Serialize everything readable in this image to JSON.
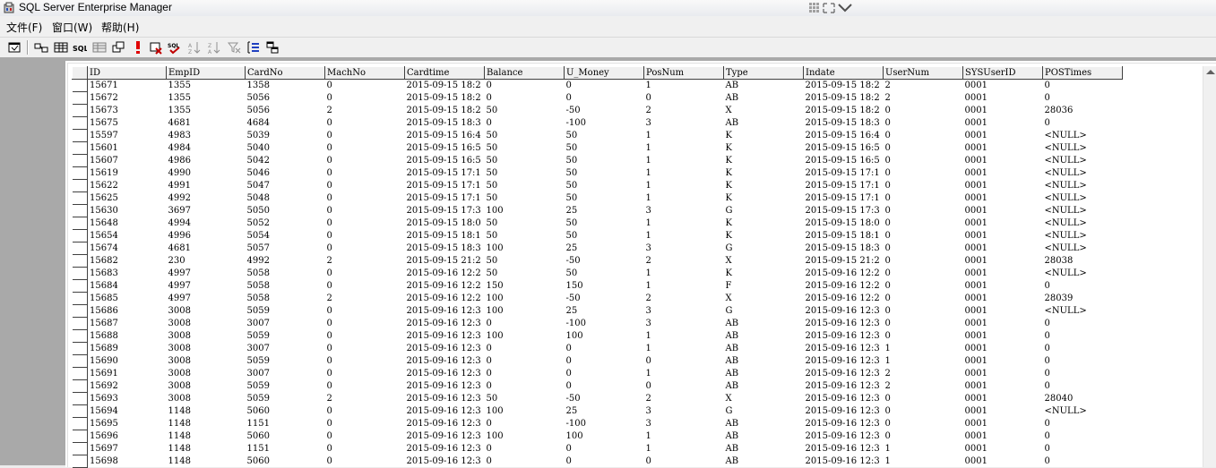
{
  "app": {
    "title": "SQL Server Enterprise Manager"
  },
  "menu": [
    {
      "label": "文件(F)"
    },
    {
      "label": "窗口(W)"
    },
    {
      "label": "帮助(H)"
    }
  ],
  "toolbar": {
    "icons": [
      "properties-icon",
      "show-diagram-pane-icon",
      "show-grid-pane-icon",
      "show-sql-pane-icon",
      "show-results-pane-icon",
      "change-query-type-icon",
      "run-icon",
      "verify-sql-icon",
      "cancel-query-icon",
      "sort-ascending-icon",
      "sort-descending-icon",
      "remove-filter-icon",
      "group-by-icon",
      "add-table-icon"
    ]
  },
  "grid": {
    "columns": [
      "ID",
      "EmpID",
      "CardNo",
      "MachNo",
      "Cardtime",
      "Balance",
      "U_Money",
      "PosNum",
      "Type",
      "Indate",
      "UserNum",
      "SYSUserID",
      "POSTimes"
    ],
    "rows": [
      [
        "15671",
        "1355",
        "1358",
        "0",
        "2015-09-15 18:2",
        "0",
        "0",
        "1",
        "AB",
        "2015-09-15 18:2",
        "2",
        "0001",
        "0"
      ],
      [
        "15672",
        "1355",
        "5056",
        "0",
        "2015-09-15 18:2",
        "0",
        "0",
        "0",
        "AB",
        "2015-09-15 18:2",
        "2",
        "0001",
        "0"
      ],
      [
        "15673",
        "1355",
        "5056",
        "2",
        "2015-09-15 18:2",
        "50",
        "-50",
        "2",
        "X",
        "2015-09-15 18:2",
        "0",
        "0001",
        "28036"
      ],
      [
        "15675",
        "4681",
        "4684",
        "0",
        "2015-09-15 18:3",
        "0",
        "-100",
        "3",
        "AB",
        "2015-09-15 18:3",
        "0",
        "0001",
        "0"
      ],
      [
        "15597",
        "4983",
        "5039",
        "0",
        "2015-09-15 16:4",
        "50",
        "50",
        "1",
        "K",
        "2015-09-15 16:4",
        "0",
        "0001",
        "<NULL>"
      ],
      [
        "15601",
        "4984",
        "5040",
        "0",
        "2015-09-15 16:5",
        "50",
        "50",
        "1",
        "K",
        "2015-09-15 16:5",
        "0",
        "0001",
        "<NULL>"
      ],
      [
        "15607",
        "4986",
        "5042",
        "0",
        "2015-09-15 16:5",
        "50",
        "50",
        "1",
        "K",
        "2015-09-15 16:5",
        "0",
        "0001",
        "<NULL>"
      ],
      [
        "15619",
        "4990",
        "5046",
        "0",
        "2015-09-15 17:1",
        "50",
        "50",
        "1",
        "K",
        "2015-09-15 17:1",
        "0",
        "0001",
        "<NULL>"
      ],
      [
        "15622",
        "4991",
        "5047",
        "0",
        "2015-09-15 17:1",
        "50",
        "50",
        "1",
        "K",
        "2015-09-15 17:1",
        "0",
        "0001",
        "<NULL>"
      ],
      [
        "15625",
        "4992",
        "5048",
        "0",
        "2015-09-15 17:1",
        "50",
        "50",
        "1",
        "K",
        "2015-09-15 17:1",
        "0",
        "0001",
        "<NULL>"
      ],
      [
        "15630",
        "3697",
        "5050",
        "0",
        "2015-09-15 17:3",
        "100",
        "25",
        "3",
        "G",
        "2015-09-15 17:3",
        "0",
        "0001",
        "<NULL>"
      ],
      [
        "15648",
        "4994",
        "5052",
        "0",
        "2015-09-15 18:0",
        "50",
        "50",
        "1",
        "K",
        "2015-09-15 18:0",
        "0",
        "0001",
        "<NULL>"
      ],
      [
        "15654",
        "4996",
        "5054",
        "0",
        "2015-09-15 18:1",
        "50",
        "50",
        "1",
        "K",
        "2015-09-15 18:1",
        "0",
        "0001",
        "<NULL>"
      ],
      [
        "15674",
        "4681",
        "5057",
        "0",
        "2015-09-15 18:3",
        "100",
        "25",
        "3",
        "G",
        "2015-09-15 18:3",
        "0",
        "0001",
        "<NULL>"
      ],
      [
        "15682",
        "230",
        "4992",
        "2",
        "2015-09-15 21:2",
        "50",
        "-50",
        "2",
        "X",
        "2015-09-15 21:2",
        "0",
        "0001",
        "28038"
      ],
      [
        "15683",
        "4997",
        "5058",
        "0",
        "2015-09-16 12:2",
        "50",
        "50",
        "1",
        "K",
        "2015-09-16 12:2",
        "0",
        "0001",
        "<NULL>"
      ],
      [
        "15684",
        "4997",
        "5058",
        "0",
        "2015-09-16 12:2",
        "150",
        "150",
        "1",
        "F",
        "2015-09-16 12:2",
        "0",
        "0001",
        "0"
      ],
      [
        "15685",
        "4997",
        "5058",
        "2",
        "2015-09-16 12:2",
        "100",
        "-50",
        "2",
        "X",
        "2015-09-16 12:2",
        "0",
        "0001",
        "28039"
      ],
      [
        "15686",
        "3008",
        "5059",
        "0",
        "2015-09-16 12:3",
        "100",
        "25",
        "3",
        "G",
        "2015-09-16 12:3",
        "0",
        "0001",
        "<NULL>"
      ],
      [
        "15687",
        "3008",
        "3007",
        "0",
        "2015-09-16 12:3",
        "0",
        "-100",
        "3",
        "AB",
        "2015-09-16 12:3",
        "0",
        "0001",
        "0"
      ],
      [
        "15688",
        "3008",
        "5059",
        "0",
        "2015-09-16 12:3",
        "100",
        "100",
        "1",
        "AB",
        "2015-09-16 12:3",
        "0",
        "0001",
        "0"
      ],
      [
        "15689",
        "3008",
        "3007",
        "0",
        "2015-09-16 12:3",
        "0",
        "0",
        "1",
        "AB",
        "2015-09-16 12:3",
        "1",
        "0001",
        "0"
      ],
      [
        "15690",
        "3008",
        "5059",
        "0",
        "2015-09-16 12:3",
        "0",
        "0",
        "0",
        "AB",
        "2015-09-16 12:3",
        "1",
        "0001",
        "0"
      ],
      [
        "15691",
        "3008",
        "3007",
        "0",
        "2015-09-16 12:3",
        "0",
        "0",
        "1",
        "AB",
        "2015-09-16 12:3",
        "2",
        "0001",
        "0"
      ],
      [
        "15692",
        "3008",
        "5059",
        "0",
        "2015-09-16 12:3",
        "0",
        "0",
        "0",
        "AB",
        "2015-09-16 12:3",
        "2",
        "0001",
        "0"
      ],
      [
        "15693",
        "3008",
        "5059",
        "2",
        "2015-09-16 12:3",
        "50",
        "-50",
        "2",
        "X",
        "2015-09-16 12:3",
        "0",
        "0001",
        "28040"
      ],
      [
        "15694",
        "1148",
        "5060",
        "0",
        "2015-09-16 12:3",
        "100",
        "25",
        "3",
        "G",
        "2015-09-16 12:3",
        "0",
        "0001",
        "<NULL>"
      ],
      [
        "15695",
        "1148",
        "1151",
        "0",
        "2015-09-16 12:3",
        "0",
        "-100",
        "3",
        "AB",
        "2015-09-16 12:3",
        "0",
        "0001",
        "0"
      ],
      [
        "15696",
        "1148",
        "5060",
        "0",
        "2015-09-16 12:3",
        "100",
        "100",
        "1",
        "AB",
        "2015-09-16 12:3",
        "0",
        "0001",
        "0"
      ],
      [
        "15697",
        "1148",
        "1151",
        "0",
        "2015-09-16 12:3",
        "0",
        "0",
        "1",
        "AB",
        "2015-09-16 12:3",
        "1",
        "0001",
        "0"
      ],
      [
        "15698",
        "1148",
        "5060",
        "0",
        "2015-09-16 12:3",
        "0",
        "0",
        "0",
        "AB",
        "2015-09-16 12:3",
        "1",
        "0001",
        "0"
      ]
    ]
  }
}
